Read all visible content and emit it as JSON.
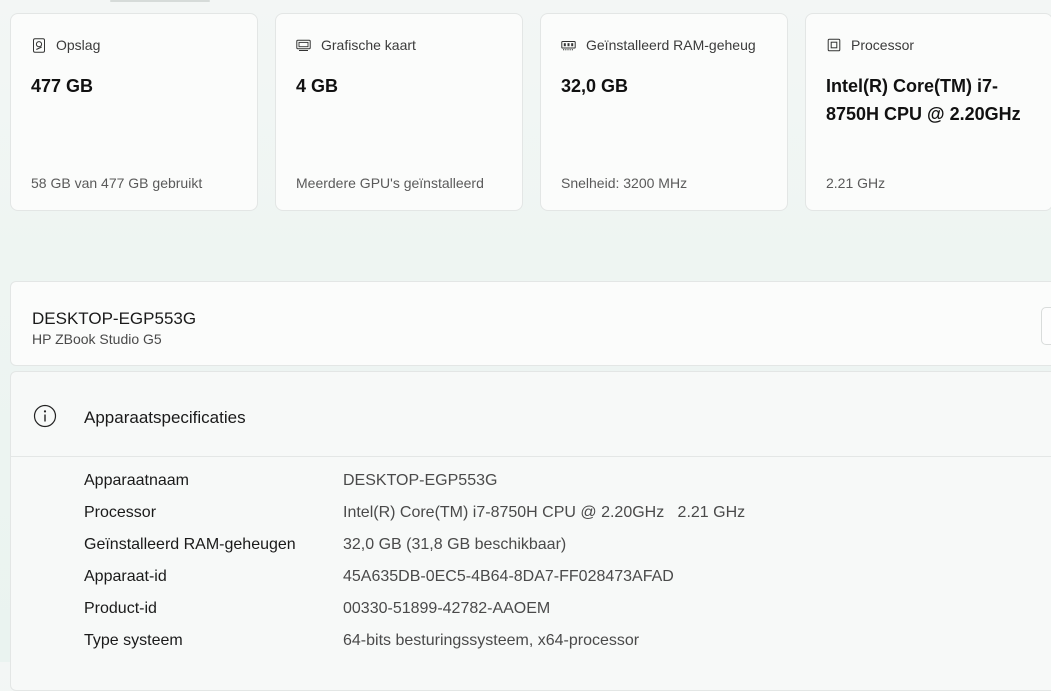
{
  "cards": [
    {
      "icon": "storage-drive-icon",
      "title": "Opslag",
      "value": "477 GB",
      "sub": "58 GB van 477 GB gebruikt"
    },
    {
      "icon": "graphics-card-icon",
      "title": "Grafische kaart",
      "value": "4 GB",
      "sub": "Meerdere GPU's geïnstalleerd"
    },
    {
      "icon": "ram-module-icon",
      "title": "Geïnstalleerd RAM-geheug",
      "value": "32,0 GB",
      "sub": "Snelheid: 3200 MHz"
    },
    {
      "icon": "processor-chip-icon",
      "title": "Processor",
      "value": "Intel(R) Core(TM) i7-8750H CPU @ 2.20GHz",
      "sub": "2.21 GHz"
    }
  ],
  "device": {
    "name": "DESKTOP-EGP553G",
    "model": "HP ZBook Studio G5"
  },
  "specs": {
    "title": "Apparaatspecificaties",
    "rows": [
      {
        "label": "Apparaatnaam",
        "value": "DESKTOP-EGP553G"
      },
      {
        "label": "Processor",
        "value": "Intel(R) Core(TM) i7-8750H CPU @ 2.20GHz   2.21 GHz"
      },
      {
        "label": "Geïnstalleerd RAM-geheugen",
        "value": "32,0 GB (31,8 GB beschikbaar)"
      },
      {
        "label": "Apparaat-id",
        "value": "45A635DB-0EC5-4B64-8DA7-FF028473AFAD"
      },
      {
        "label": "Product-id",
        "value": "00330-51899-42782-AAOEM"
      },
      {
        "label": "Type systeem",
        "value": "64-bits besturingssysteem, x64-processor"
      }
    ]
  },
  "colors": {
    "page_background": "#eef5f2",
    "card_background": "#fbfcfb",
    "border": "#e3e6e5",
    "secondary_text": "#5a5a5a"
  }
}
